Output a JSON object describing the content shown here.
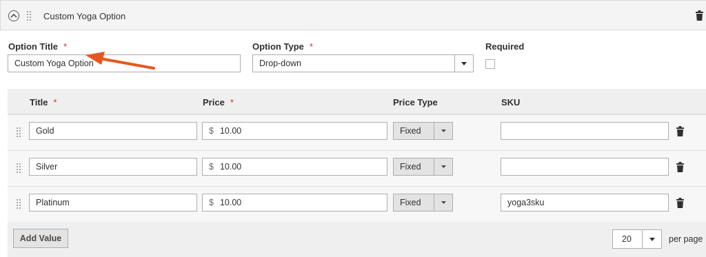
{
  "option": {
    "header_title": "Custom Yoga Option",
    "title_label": "Option Title",
    "title_value": "Custom Yoga Option",
    "type_label": "Option Type",
    "type_value": "Drop-down",
    "required_label": "Required",
    "required_checked": false,
    "required_marker": "*"
  },
  "grid": {
    "columns": {
      "title": "Title",
      "price": "Price",
      "price_type": "Price Type",
      "sku": "SKU"
    },
    "rows": [
      {
        "title": "Gold",
        "currency": "$",
        "price": "10.00",
        "price_type": "Fixed",
        "sku": ""
      },
      {
        "title": "Silver",
        "currency": "$",
        "price": "10.00",
        "price_type": "Fixed",
        "sku": ""
      },
      {
        "title": "Platinum",
        "currency": "$",
        "price": "10.00",
        "price_type": "Fixed",
        "sku": "yoga3sku"
      }
    ]
  },
  "footer": {
    "add_value_label": "Add Value",
    "per_page_value": "20",
    "per_page_label": "per page"
  },
  "colors": {
    "required_asterisk": "#e22626",
    "annotation_arrow": "#e8561f"
  },
  "icons": {
    "collapse": "chevron-up-circle-icon",
    "drag": "drag-handle-icon",
    "delete": "trash-icon",
    "dropdown": "triangle-down-icon"
  }
}
